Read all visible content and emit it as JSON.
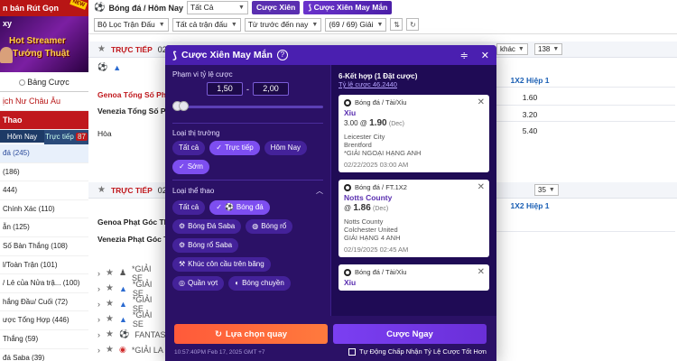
{
  "left": {
    "banner_text": "n bán Rút Gọn",
    "new_badge": "NEW",
    "promo_lines": [
      "xy",
      "Hot Streamer",
      "Tướng Thuật"
    ],
    "tabs": [
      "Bảng Cược"
    ],
    "schedule": "ịch Nư Châu Âu",
    "section": "Thao",
    "subtabs": [
      "Hôm Nay",
      "Trực tiếp"
    ],
    "subtab_badge": "87",
    "items": [
      "đá (245)",
      "(186)",
      "444)",
      "Chính Xác (110)",
      "ẵn (125)",
      "Số Bàn Thắng (108)",
      "l/Toàn Trận (101)",
      "/ Lẻ của Nửa trậ... (100)",
      "hắng Đầu/ Cuối (72)",
      "ược Tổng Hợp (446)",
      "Thắng (59)",
      "đá Saba (39)"
    ]
  },
  "topbar": {
    "sport": "Bóng đá / Hôm Nay",
    "all": "Tất Cả",
    "combo": "Cược Xiên",
    "combo_lucky": "Cược Xiên May Mắn",
    "filter": "Bộ Lọc Trận Đấu",
    "all_matches": "Tất cả trận đấu",
    "sort": "Từ trước đến nay",
    "count": "(69 / 69) Giải"
  },
  "main": {
    "live": "TRỰC TIẾP",
    "live_code": "02",
    "live_code_2": "02",
    "other_btn": "khác",
    "count_138": "138",
    "count_35": "35",
    "hiep_hdr": "1X2 Hiệp 1",
    "hiep_hdr2": "1X2 Hiệp 1",
    "match1": "Genoa Tổng Số Phạ",
    "match2": "Venezia Tổng Số Ph",
    "match3": "Hòa",
    "odds": [
      "1.60",
      "3.20",
      "5.40"
    ],
    "match4": "Genoa Phạt Góc Th",
    "match5": "Venezia Phạt Góc Th",
    "gs_label": "*GIẢI SE",
    "gs_label_short": "*GIẢI SE",
    "gs_label_la": "*GIẢI LA",
    "fantasy": "FANTAS"
  },
  "modal": {
    "title": "Cược Xiên May Mắn",
    "help": "?",
    "odds_range_label": "Phạm vi tỷ lệ cược",
    "range_from": "1,50",
    "range_dash": "-",
    "range_to": "2,00",
    "market_type_label": "Loại thị trường",
    "market_types": [
      {
        "label": "Tất cả",
        "active": false
      },
      {
        "label": "Trực tiếp",
        "active": true
      },
      {
        "label": "Hôm Nay",
        "active": false
      },
      {
        "label": "Sớm",
        "active": true
      }
    ],
    "sport_type_label": "Loại thể thao",
    "sports": [
      {
        "label": "Tất cả",
        "icon": "",
        "active": false
      },
      {
        "label": "Bóng đá",
        "icon": "soccer-ball-icon",
        "active": true
      },
      {
        "label": "Bóng Đá Saba",
        "icon": "soccer-saba-icon",
        "active": false
      },
      {
        "label": "Bóng rổ",
        "icon": "basketball-icon",
        "active": false
      },
      {
        "label": "Bóng rổ Saba",
        "icon": "basketball-saba-icon",
        "active": false
      },
      {
        "label": "Khúc côn cầu trên băng",
        "icon": "ice-hockey-icon",
        "active": false
      },
      {
        "label": "Quần vợt",
        "icon": "tennis-icon",
        "active": false
      },
      {
        "label": "Bóng chuyền",
        "icon": "volleyball-icon",
        "active": false
      }
    ],
    "combination": "6-Kết hợp (1 Đặt cược)",
    "total_odds": "Tỷ lệ cược 46.2440",
    "picks": [
      {
        "market": "Bóng đá / Tài/Xỉu",
        "pick": "Xỉu",
        "handicap": "3.00",
        "price": "1.90",
        "fmt": "(Dec)",
        "team1": "Leicester City",
        "team2": "Brentford",
        "league": "*GIẢI NGOẠI HẠNG ANH",
        "time": "02/22/2025 03:00 AM"
      },
      {
        "market": "Bóng đá / FT.1X2",
        "pick": "Notts County",
        "handicap": "",
        "price": "1.86",
        "fmt": "(Dec)",
        "team1": "Notts County",
        "team2": "Colchester United",
        "league": "GIẢI HẠNG 4 ANH",
        "time": "02/19/2025 02:45 AM"
      },
      {
        "market": "Bóng đá / Tài/Xỉu",
        "pick": "Xỉu",
        "handicap": "",
        "price": "",
        "fmt": "",
        "team1": "",
        "team2": "",
        "league": "",
        "time": ""
      }
    ],
    "btn_reroll": "Lựa chọn quay",
    "btn_bet": "Cược Ngay",
    "timestamp": "10:57:40PM Feb 17, 2025 GMT +7",
    "auto_accept": "Tự Động Chấp Nhận Tỷ Lệ Cược Tốt Hơn"
  },
  "colors": {
    "modal_bg": "#2b1166",
    "modal_header": "#4a1fb0",
    "accent": "#7d4ef0",
    "orange": "#ff5a3a",
    "live_red": "#c0181d"
  }
}
